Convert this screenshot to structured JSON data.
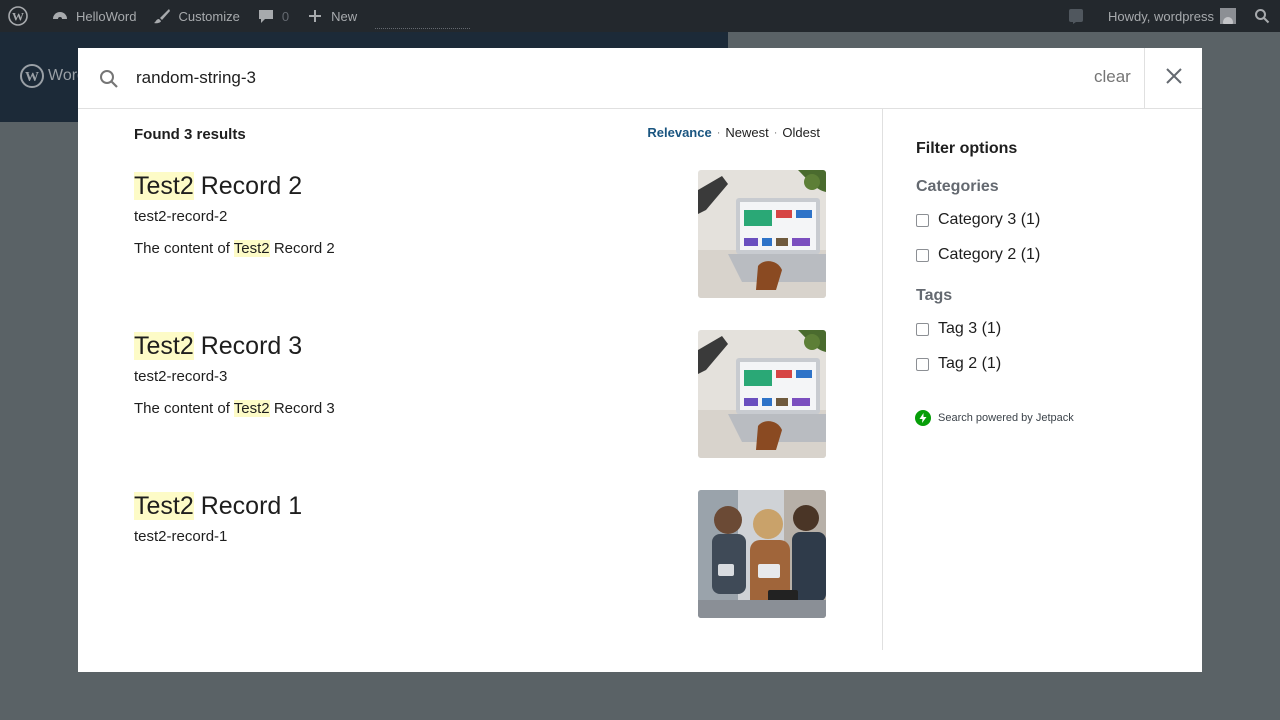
{
  "adminbar": {
    "site_name": "HelloWord",
    "customize": "Customize",
    "comments_count": "0",
    "new_label": "New",
    "greeting": "Howdy, wordpress"
  },
  "site": {
    "logo_text": "WordPress"
  },
  "search": {
    "query": "random-string-3",
    "clear_label": "clear"
  },
  "results": {
    "summary": "Found 3 results",
    "sort": {
      "relevance": "Relevance",
      "newest": "Newest",
      "oldest": "Oldest",
      "separator": "·"
    },
    "items": [
      {
        "highlight": "Test2",
        "title_rest": " Record 2",
        "path": "test2-record-2",
        "content_prefix": "The content of ",
        "content_highlight": "Test2",
        "content_rest": " Record 2",
        "thumbnail": "laptop"
      },
      {
        "highlight": "Test2",
        "title_rest": " Record 3",
        "path": "test2-record-3",
        "content_prefix": "The content of ",
        "content_highlight": "Test2",
        "content_rest": " Record 3",
        "thumbnail": "laptop"
      },
      {
        "highlight": "Test2",
        "title_rest": " Record 1",
        "path": "test2-record-1",
        "thumbnail": "people-with-devices"
      }
    ]
  },
  "filters": {
    "title": "Filter options",
    "categories_heading": "Categories",
    "categories": [
      "Category 3 (1)",
      "Category 2 (1)"
    ],
    "tags_heading": "Tags",
    "tags": [
      "Tag 3 (1)",
      "Tag 2 (1)"
    ],
    "powered_by": "Search powered by Jetpack"
  },
  "colors": {
    "highlight": "#fdfbc7",
    "accent": "#1a5580",
    "jetpack": "#069e08",
    "overlay": "#5a6266"
  }
}
